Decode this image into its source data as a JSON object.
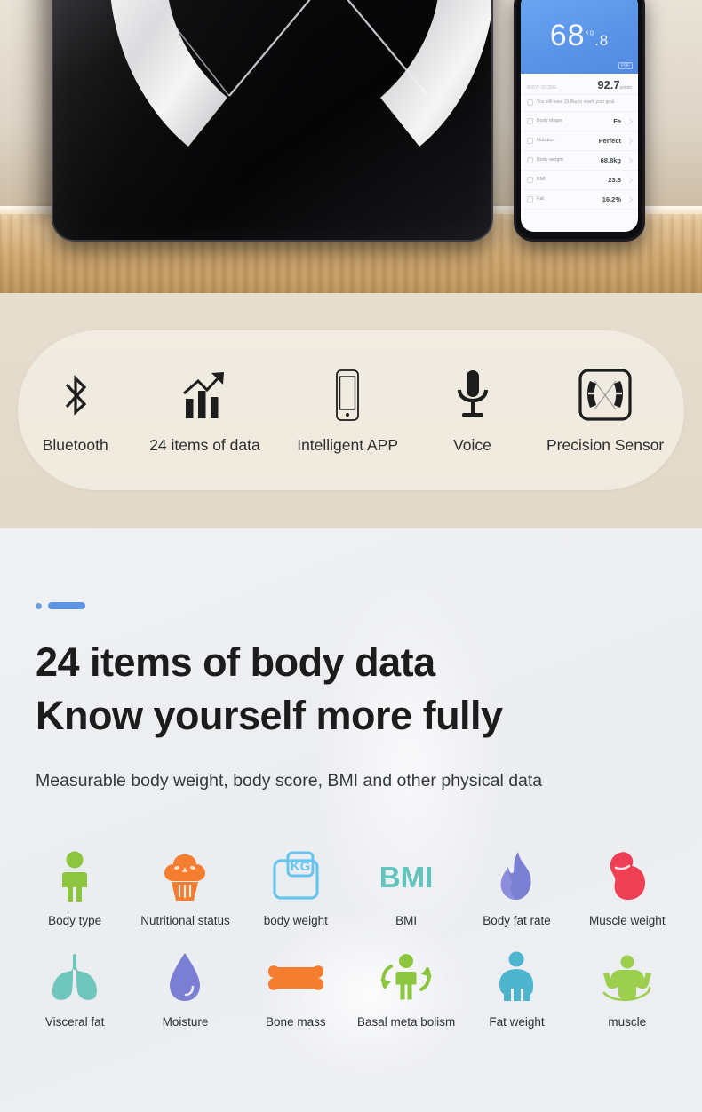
{
  "hero": {
    "product_name": "smart-body-fat-scale",
    "scale_surface_color": "#0a0a0c",
    "phone": {
      "header_bg": "#5b95e8",
      "weight_whole": "68",
      "weight_decimal": ".8",
      "weight_unit": "kg",
      "badge": "PDF",
      "score_label": "BODY SCORE",
      "score_value": "92.7",
      "score_unit": "points",
      "goal_text": "You still have 15.8kg to reach your goal.",
      "rows": [
        {
          "icon": "body-shape-icon",
          "label": "Body shape",
          "value": "Fa"
        },
        {
          "icon": "nutrition-icon",
          "label": "Nutrition",
          "value": "Perfect"
        },
        {
          "icon": "body-weight-icon",
          "label": "Body weight",
          "value": "68.8kg"
        },
        {
          "icon": "bmi-icon",
          "label": "BMI",
          "value": "23.8"
        },
        {
          "icon": "fat-icon",
          "label": "Fat",
          "value": "16.2%"
        }
      ]
    }
  },
  "features": {
    "bg_color": "#e4dacb",
    "items": [
      {
        "icon": "bluetooth-icon",
        "label": "Bluetooth"
      },
      {
        "icon": "bar-chart-growth-icon",
        "label": "24 items of data"
      },
      {
        "icon": "smartphone-icon",
        "label": "Intelligent APP"
      },
      {
        "icon": "microphone-icon",
        "label": "Voice"
      },
      {
        "icon": "precision-sensor-icon",
        "label": "Precision Sensor"
      }
    ]
  },
  "body_data": {
    "bg_color": "#eceef2",
    "accent_color": "#5d95e4",
    "headline_line1": "24 items of body data",
    "headline_line2": "Know yourself more fully",
    "subheadline": "Measurable body weight, body score, BMI and other physical data",
    "items": [
      {
        "icon": "body-type-icon",
        "label": "Body type",
        "color": "#8cc63f"
      },
      {
        "icon": "cupcake-icon",
        "label": "Nutritional status",
        "color": "#f47d30"
      },
      {
        "icon": "kg-scale-icon",
        "label": "body weight",
        "color": "#66c5ef"
      },
      {
        "icon": "bmi-text-icon",
        "label": "BMI",
        "color": "#63c4bd"
      },
      {
        "icon": "flame-icon",
        "label": "Body fat rate",
        "color": "#7b7fd4"
      },
      {
        "icon": "bicep-icon",
        "label": "Muscle weight",
        "color": "#ef3f55"
      },
      {
        "icon": "lungs-icon",
        "label": "Visceral fat",
        "color": "#6ec6bd"
      },
      {
        "icon": "water-drop-icon",
        "label": "Moisture",
        "color": "#7b7fd4"
      },
      {
        "icon": "bone-icon",
        "label": "Bone mass",
        "color": "#f47d30"
      },
      {
        "icon": "metabolism-icon",
        "label": "Basal meta bolism",
        "color": "#8cc63f"
      },
      {
        "icon": "fat-weight-icon",
        "label": "Fat weight",
        "color": "#4db5cd"
      },
      {
        "icon": "muscle-figure-icon",
        "label": "muscle",
        "color": "#9ccf4e"
      }
    ]
  }
}
